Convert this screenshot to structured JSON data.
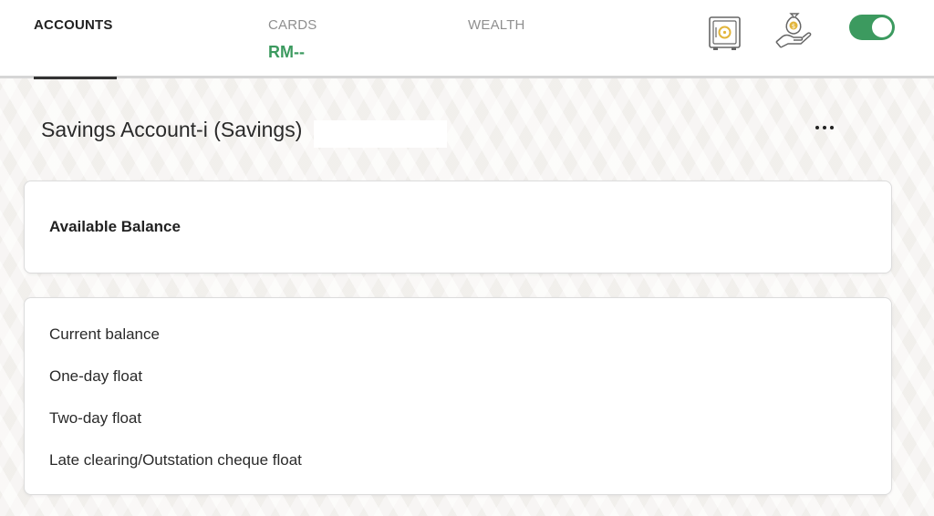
{
  "tabs": {
    "accounts": "ACCOUNTS",
    "cards": "CARDS",
    "cards_value": "RM--",
    "wealth": "WEALTH"
  },
  "icons": {
    "safe": "safe-icon",
    "money": "money-bag-hand-icon",
    "toggle_state": "on"
  },
  "colors": {
    "accent": "#3c9a5f",
    "icon_gold": "#e2b53b"
  },
  "account": {
    "title": "Savings Account-i (Savings)"
  },
  "available": {
    "label": "Available Balance"
  },
  "details": {
    "rows": [
      "Current balance",
      "One-day float",
      "Two-day float",
      "Late clearing/Outstation cheque float"
    ]
  }
}
